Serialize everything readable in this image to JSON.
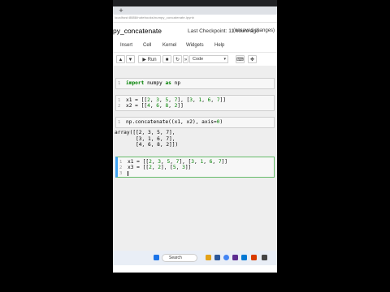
{
  "browser": {
    "url": "localhost:8888/notebooks/numpy_concatenate.ipynb"
  },
  "notebook": {
    "title": "py_concatenate",
    "checkpoint": "Last Checkpoint: 11 hours ago",
    "status": "(unsaved changes)"
  },
  "menu": [
    "Insert",
    "Cell",
    "Kernel",
    "Widgets",
    "Help"
  ],
  "toolbar": {
    "run_label": "Run",
    "cell_type": "Code"
  },
  "cells": {
    "c1": {
      "prompt": "1"
    },
    "c2": {
      "prompt1": "1",
      "prompt2": "2"
    },
    "c3": {
      "prompt": "1",
      "output": "array([[2, 3, 5, 7],\n       [3, 1, 6, 7],\n       [4, 6, 8, 2]])"
    },
    "c4": {
      "prompt1": "1",
      "prompt2": "2",
      "prompt3": "3"
    }
  },
  "taskbar": {
    "search_placeholder": "Search"
  }
}
